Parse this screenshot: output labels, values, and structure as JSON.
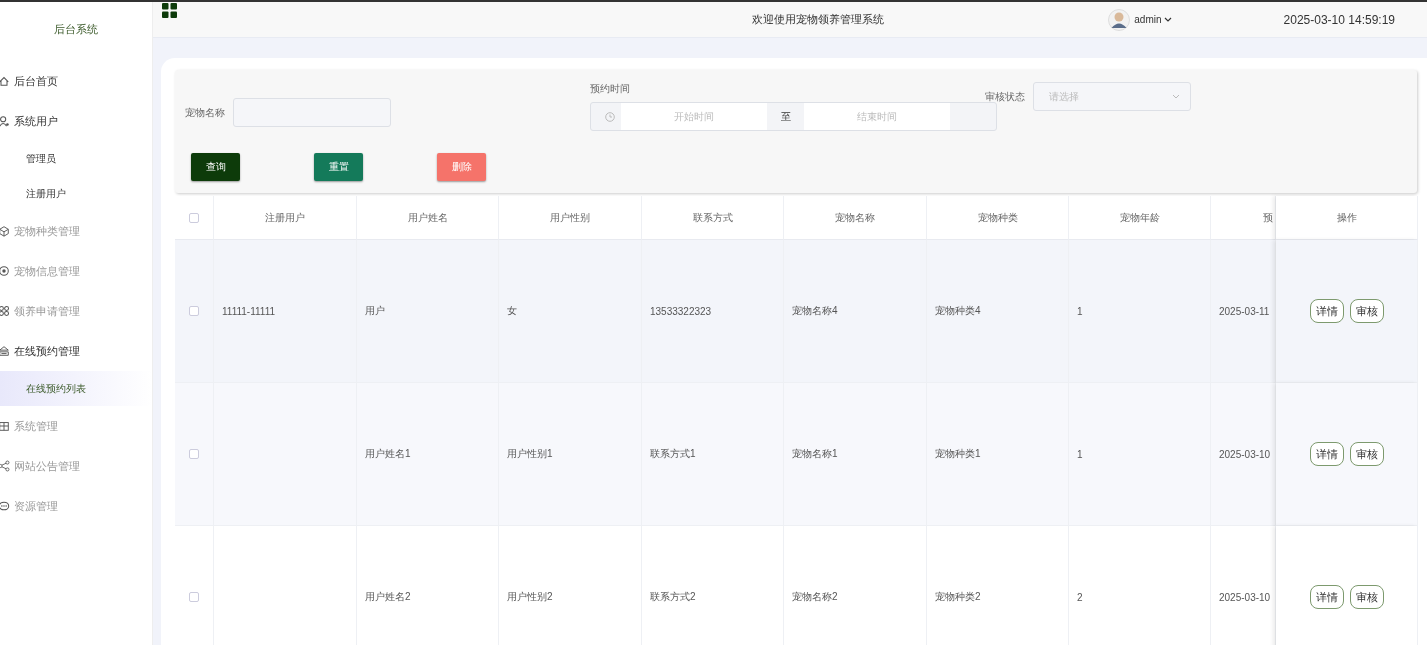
{
  "sidebar": {
    "title": "后台系统",
    "items": [
      {
        "label": "后台首页",
        "expanded": true
      },
      {
        "label": "系统用户",
        "expanded": true,
        "children": [
          {
            "label": "管理员",
            "selected": false
          },
          {
            "label": "注册用户",
            "selected": false
          }
        ]
      },
      {
        "label": "宠物种类管理",
        "expanded": false
      },
      {
        "label": "宠物信息管理",
        "expanded": false
      },
      {
        "label": "领养申请管理",
        "expanded": false
      },
      {
        "label": "在线预约管理",
        "expanded": true,
        "children": [
          {
            "label": "在线预约列表",
            "selected": true
          }
        ]
      },
      {
        "label": "系统管理",
        "expanded": false
      },
      {
        "label": "网站公告管理",
        "expanded": false
      },
      {
        "label": "资源管理",
        "expanded": false
      }
    ]
  },
  "header": {
    "title": "欢迎使用宠物领养管理系统",
    "user": "admin",
    "datetime": "2025-03-10 14:59:19"
  },
  "filters": {
    "pet_name": {
      "label": "宠物名称"
    },
    "time": {
      "label": "预约时间",
      "start_placeholder": "开始时间",
      "separator": "至",
      "end_placeholder": "结束时间"
    },
    "status": {
      "label": "审核状态",
      "placeholder": "请选择"
    }
  },
  "buttons": [
    {
      "label": "查询",
      "kind": "query"
    },
    {
      "label": "重置",
      "kind": "reset"
    },
    {
      "label": "删除",
      "kind": "delete"
    }
  ],
  "table": {
    "all_checked": false,
    "columns": [
      "注册用户",
      "用户姓名",
      "用户性别",
      "联系方式",
      "宠物名称",
      "宠物种类",
      "宠物年龄",
      "预"
    ],
    "action_column": "操作",
    "rows": [
      {
        "checked": false,
        "cells": [
          "11111-11111",
          "用户",
          "女",
          "13533322323",
          "宠物名称4",
          "宠物种类4",
          "1",
          "2025-03-11"
        ],
        "actions": [
          "详情",
          "审核"
        ]
      },
      {
        "checked": false,
        "cells": [
          "",
          "用户姓名1",
          "用户性别1",
          "联系方式1",
          "宠物名称1",
          "宠物种类1",
          "1",
          "2025-03-10"
        ],
        "actions": [
          "详情",
          "审核"
        ]
      },
      {
        "checked": false,
        "cells": [
          "",
          "用户姓名2",
          "用户性别2",
          "联系方式2",
          "宠物名称2",
          "宠物种类2",
          "2",
          "2025-03-10"
        ],
        "actions": [
          "详情",
          "审核"
        ]
      }
    ]
  }
}
